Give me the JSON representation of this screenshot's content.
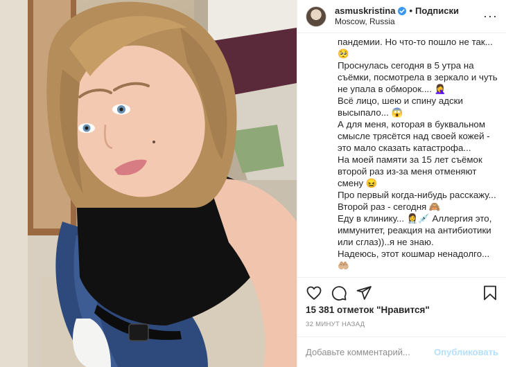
{
  "header": {
    "username": "asmuskristina",
    "verified_icon": "verified-badge-icon",
    "separator": "•",
    "follow_label": "Подписки",
    "location": "Moscow, Russia",
    "more_label": "···"
  },
  "caption": {
    "lines": [
      "пандемии. Но что-то пошло не так...",
      "🥺",
      "Проснулась сегодня в 5 утра на съёмки, посмотрела в зеркало и чуть не упала в обморок.... 🤦‍♀️",
      "Всё лицо, шею и спину адски высыпало... 😱",
      "А для меня, которая в буквальном смысле трясётся над своей кожей - это мало сказать катастрофа...",
      "На моей памяти за 15 лет съёмок второй раз из-за меня отменяют смену 😖",
      "Про первый когда-нибудь расскажу... Второй раз - сегодня 🙈",
      "Еду в клинику... 👩‍⚕️💉 Аллергия это, иммунитет, реакция на антибиотики или сглаз))..я не знаю.",
      "Надеюсь, этот кошмар ненадолго...",
      "🤲🏼"
    ]
  },
  "actions": {
    "like_icon": "heart-icon",
    "comment_icon": "comment-bubble-icon",
    "share_icon": "paper-plane-icon",
    "save_icon": "bookmark-icon"
  },
  "likes_text": "15 381 отметок \"Нравится\"",
  "time_text": "32 минут назад",
  "comment": {
    "placeholder": "Добавьте комментарий...",
    "publish_label": "Опубликовать"
  },
  "colors": {
    "accent_blue": "#0095f6",
    "publish_disabled": "#b2dffc",
    "muted": "#8e8e8e",
    "border": "#efefef"
  }
}
